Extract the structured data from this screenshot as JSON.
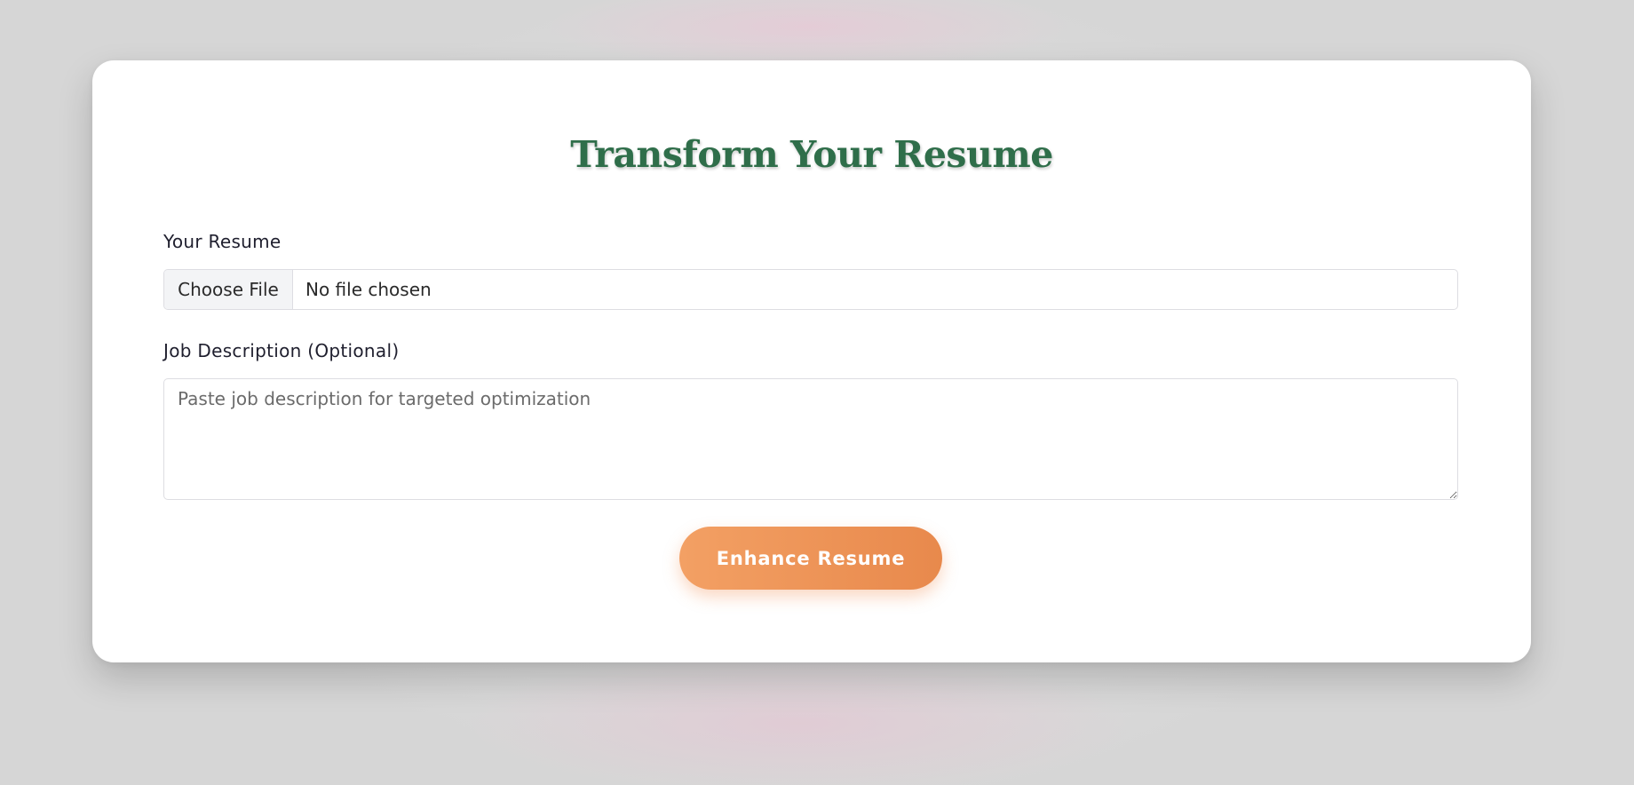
{
  "form": {
    "title": "Transform Your Resume",
    "resume_label": "Your Resume",
    "file_button_label": "Choose File",
    "file_status": "No file chosen",
    "job_label": "Job Description (Optional)",
    "job_placeholder": "Paste job description for targeted optimization",
    "job_value": "",
    "submit_label": "Enhance Resume"
  },
  "colors": {
    "title": "#2f6e4a",
    "button_gradient_start": "#f3a064",
    "button_gradient_end": "#e8894c",
    "card_background": "#ffffff",
    "page_background": "#dcdcdc"
  }
}
